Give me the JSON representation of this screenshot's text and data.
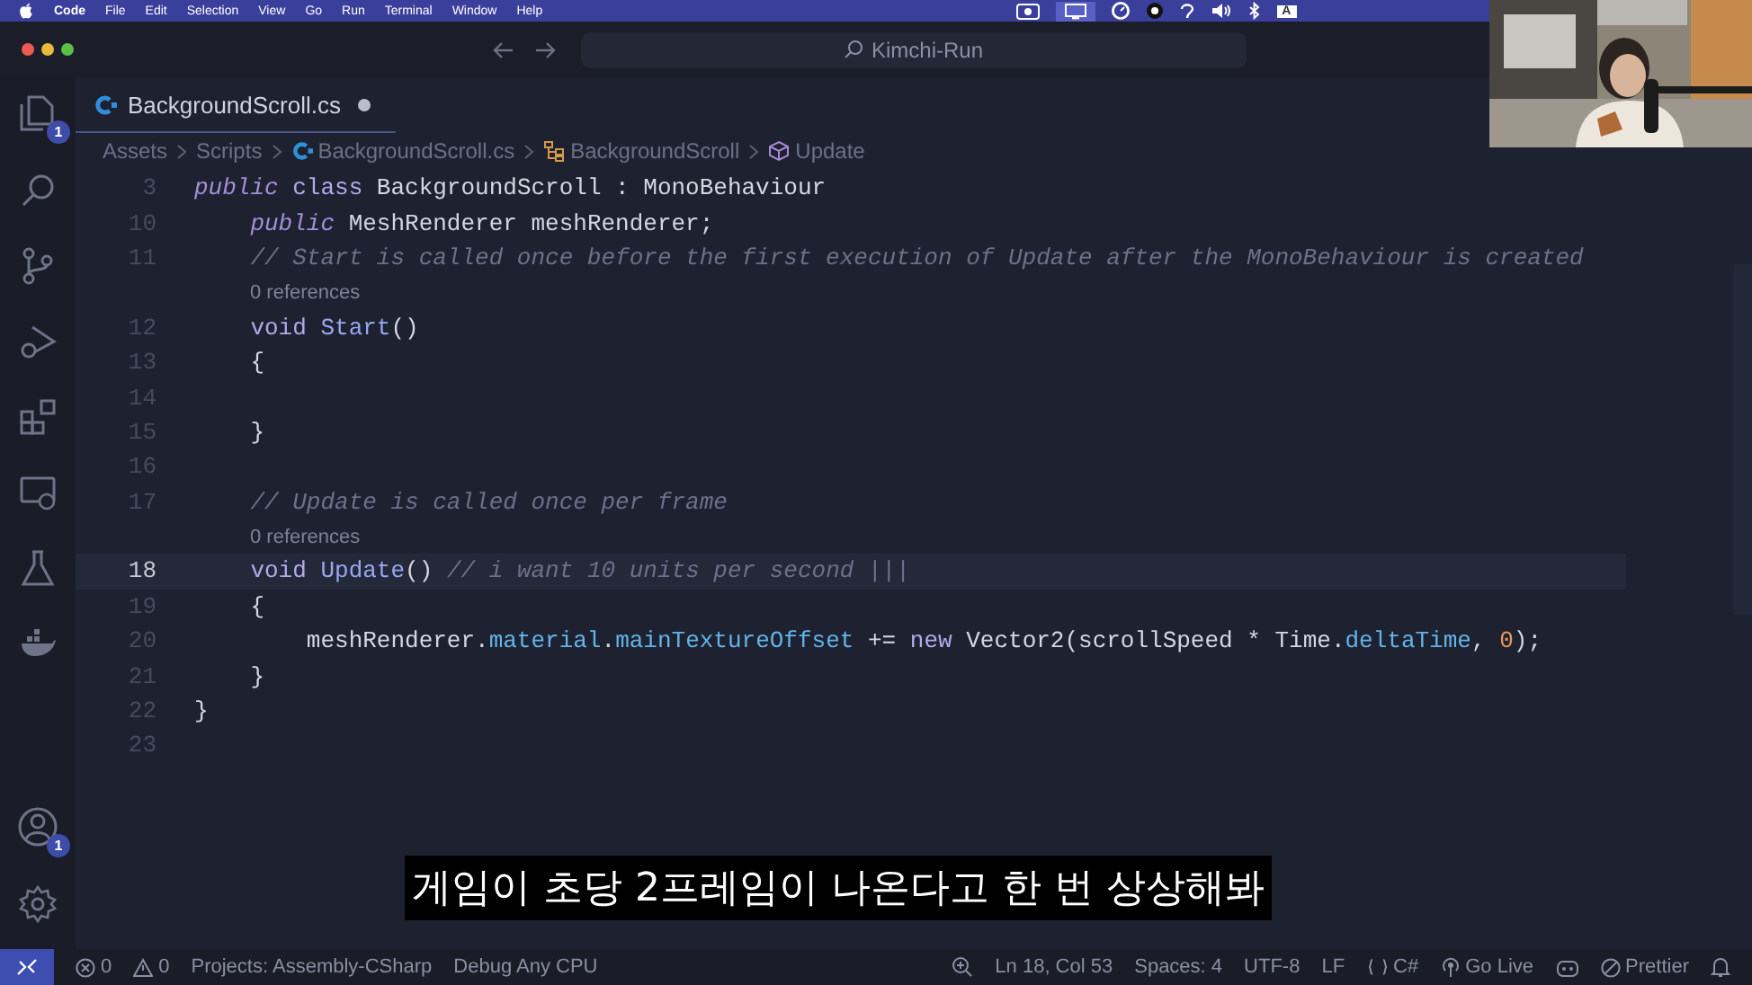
{
  "menu_bar": {
    "items": [
      "Code",
      "File",
      "Edit",
      "Selection",
      "View",
      "Go",
      "Run",
      "Terminal",
      "Window",
      "Help"
    ],
    "input_source": "A"
  },
  "title_bar": {
    "search": "Kimchi-Run"
  },
  "activity_bar": {
    "explorer_badge": "1",
    "accounts_badge": "1"
  },
  "tab": {
    "label": "BackgroundScroll.cs",
    "modified": true
  },
  "breadcrumbs": [
    {
      "label": "Assets",
      "kind": "folder"
    },
    {
      "label": "Scripts",
      "kind": "folder"
    },
    {
      "label": "BackgroundScroll.cs",
      "kind": "file"
    },
    {
      "label": "BackgroundScroll",
      "kind": "class"
    },
    {
      "label": "Update",
      "kind": "method"
    }
  ],
  "code_lines": [
    {
      "kind": "code",
      "number": "3",
      "tokens": [
        {
          "text": "public",
          "kind": "modifier"
        },
        {
          "text": " class",
          "kind": "keyword"
        },
        {
          "text": " BackgroundScroll : MonoBehaviour",
          "kind": "plain"
        }
      ]
    },
    {
      "kind": "code",
      "number": "10",
      "tokens": [
        {
          "text": "    public",
          "kind": "modifier"
        },
        {
          "text": " MeshRenderer meshRenderer;",
          "kind": "plain"
        }
      ]
    },
    {
      "kind": "code",
      "number": "11",
      "tokens": [
        {
          "text": "    // Start is called once before the first execution of Update after the MonoBehaviour is created",
          "kind": "comment"
        }
      ]
    },
    {
      "kind": "codelens",
      "text": "0 references"
    },
    {
      "kind": "code",
      "number": "12",
      "tokens": [
        {
          "text": "    void",
          "kind": "keyword"
        },
        {
          "text": " Start",
          "kind": "function"
        },
        {
          "text": "()",
          "kind": "plain"
        }
      ]
    },
    {
      "kind": "code",
      "number": "13",
      "tokens": [
        {
          "text": "    {",
          "kind": "plain"
        }
      ]
    },
    {
      "kind": "code",
      "number": "14"
    },
    {
      "kind": "code",
      "number": "15",
      "tokens": [
        {
          "text": "    }",
          "kind": "plain"
        }
      ]
    },
    {
      "kind": "code",
      "number": "16"
    },
    {
      "kind": "code",
      "number": "17",
      "tokens": [
        {
          "text": "    // Update is called once per frame",
          "kind": "comment"
        }
      ]
    },
    {
      "kind": "codelens",
      "text": "0 references"
    },
    {
      "kind": "code",
      "number": "18",
      "current": true,
      "tokens": [
        {
          "text": "    void",
          "kind": "keyword"
        },
        {
          "text": " Update",
          "kind": "function"
        },
        {
          "text": "()",
          "kind": "plain"
        },
        {
          "text": " // i want 10 units per second |||",
          "kind": "comment"
        }
      ]
    },
    {
      "kind": "code",
      "number": "19",
      "tokens": [
        {
          "text": "    {",
          "kind": "plain"
        }
      ]
    },
    {
      "kind": "code",
      "number": "20",
      "tokens": [
        {
          "text": "        meshRenderer.",
          "kind": "plain"
        },
        {
          "text": "material",
          "kind": "member"
        },
        {
          "text": ".",
          "kind": "plain"
        },
        {
          "text": "mainTextureOffset",
          "kind": "member"
        },
        {
          "text": " += ",
          "kind": "plain"
        },
        {
          "text": "new",
          "kind": "keyword"
        },
        {
          "text": " Vector2(scrollSpeed * Time.",
          "kind": "plain"
        },
        {
          "text": "deltaTime",
          "kind": "member"
        },
        {
          "text": ", ",
          "kind": "plain"
        },
        {
          "text": "0",
          "kind": "number"
        },
        {
          "text": ");",
          "kind": "plain"
        }
      ]
    },
    {
      "kind": "code",
      "number": "21",
      "tokens": [
        {
          "text": "    }",
          "kind": "plain"
        }
      ]
    },
    {
      "kind": "code",
      "number": "22",
      "tokens": [
        {
          "text": "}",
          "kind": "plain"
        }
      ]
    },
    {
      "kind": "code",
      "number": "23"
    }
  ],
  "subtitle": "게임이 초당 2프레임이 나온다고 한 번 상상해봐",
  "status_bar": {
    "left": [
      {
        "text": "0",
        "kind": "errors"
      },
      {
        "text": "0",
        "kind": "warnings"
      },
      {
        "text": "Projects: Assembly-CSharp",
        "kind": "text"
      },
      {
        "text": "Debug Any CPU",
        "kind": "text"
      }
    ],
    "right": [
      {
        "kind": "zoom"
      },
      {
        "text": "Ln 18, Col 53",
        "kind": "text"
      },
      {
        "text": "Spaces: 4",
        "kind": "text"
      },
      {
        "text": "UTF-8",
        "kind": "text"
      },
      {
        "text": "LF",
        "kind": "text"
      },
      {
        "text": "C#",
        "kind": "language"
      },
      {
        "text": "Go Live",
        "kind": "live"
      },
      {
        "kind": "copilot"
      },
      {
        "text": "Prettier",
        "kind": "formatter"
      },
      {
        "kind": "notifications"
      }
    ]
  }
}
